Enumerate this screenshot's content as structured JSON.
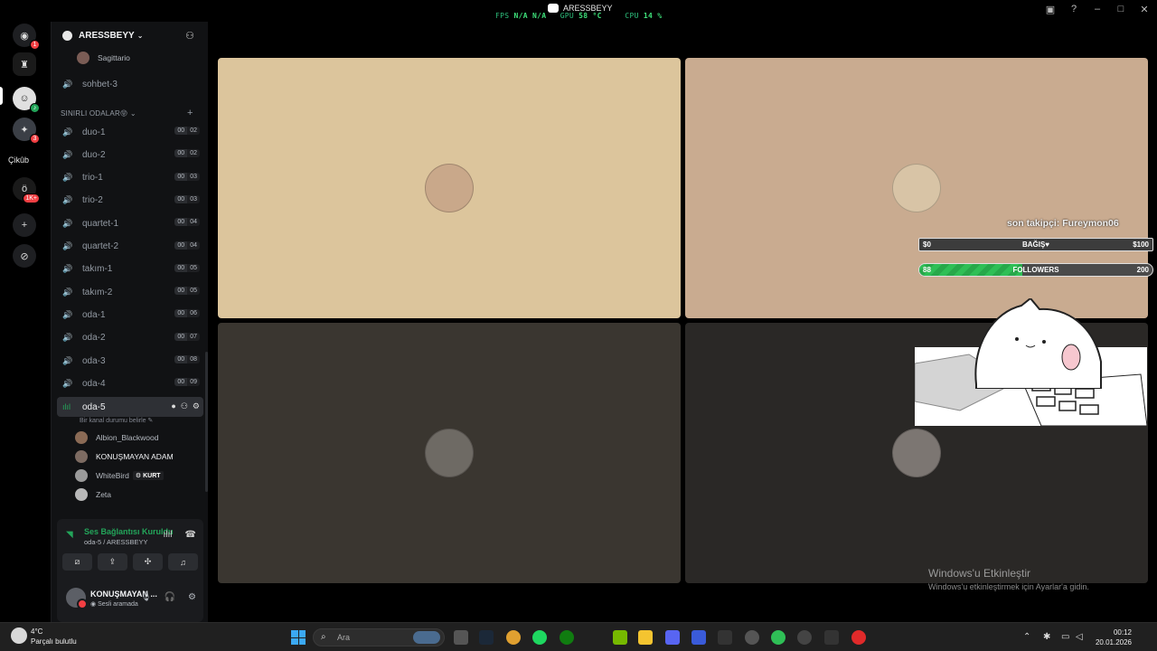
{
  "titlebar": {
    "perf_fps_label": "FPS",
    "perf_fps_value": "N/A",
    "perf_na2": "N/A",
    "perf_gpu_label": "GPU",
    "perf_gpu_value": "58 °C",
    "perf_cpu_label": "CPU",
    "perf_cpu_value": "14 %",
    "window_title": "ARESSBEYY"
  },
  "rail": {
    "badge_discord": "1",
    "badge_server2": "3",
    "label_cikub": "Çikûb",
    "badge_server3": "1K+"
  },
  "server": {
    "name": "ARESSBEYY"
  },
  "channels": {
    "top_member": "Sagittario",
    "sohbet3": "sohbet-3",
    "category": "SINIRLI ODALAR😝",
    "list": [
      {
        "name": "duo-1",
        "a": "00",
        "b": "02"
      },
      {
        "name": "duo-2",
        "a": "00",
        "b": "02"
      },
      {
        "name": "trio-1",
        "a": "00",
        "b": "03"
      },
      {
        "name": "trio-2",
        "a": "00",
        "b": "03"
      },
      {
        "name": "quartet-1",
        "a": "00",
        "b": "04"
      },
      {
        "name": "quartet-2",
        "a": "00",
        "b": "04"
      },
      {
        "name": "takım-1",
        "a": "00",
        "b": "05"
      },
      {
        "name": "takım-2",
        "a": "00",
        "b": "05"
      },
      {
        "name": "oda-1",
        "a": "00",
        "b": "06"
      },
      {
        "name": "oda-2",
        "a": "00",
        "b": "07"
      },
      {
        "name": "oda-3",
        "a": "00",
        "b": "08"
      },
      {
        "name": "oda-4",
        "a": "00",
        "b": "09"
      }
    ],
    "active": {
      "name": "oda-5",
      "status": "Bir kanal durumu belirle"
    },
    "members": [
      {
        "name": "Albion_Blackwood"
      },
      {
        "name": "KONUŞMAYAN ADAM"
      },
      {
        "name": "WhiteBird",
        "tag": "KURT"
      },
      {
        "name": "Zeta"
      }
    ]
  },
  "voice_panel": {
    "title": "Ses Bağlantısı Kuruldu",
    "subtitle": "oda-5 / ARESSBEYY",
    "user_name": "KONUŞMAYAN ...",
    "user_status": "Sesli aramada"
  },
  "stage": {
    "tiles": [
      {
        "bg": "#dcc59c",
        "avatar": "#c9a88a"
      },
      {
        "bg": "#c9ab90",
        "avatar": "#d8c4a6"
      },
      {
        "bg": "#3a3630",
        "avatar": "#6e6a64"
      },
      {
        "bg": "#2a2826",
        "avatar": "#7c7672"
      }
    ]
  },
  "overlay": {
    "last_follower": "son takipçi: Fureymon06",
    "donation_left": "$0",
    "donation_label": "BAĞIŞ♥",
    "donation_right": "$100",
    "followers_left": "88",
    "followers_label": "FOLLOWERS",
    "followers_right": "200",
    "followers_progress": 0.44
  },
  "watermark": {
    "title": "Windows'u Etkinleştir",
    "subtitle": "Windows'u etkinleştirmek için Ayarlar'a gidin."
  },
  "taskbar": {
    "temp": "4°C",
    "condition": "Parçalı bulutlu",
    "search_placeholder": "Ara",
    "time": "00:12",
    "date": "20.01.2026"
  }
}
